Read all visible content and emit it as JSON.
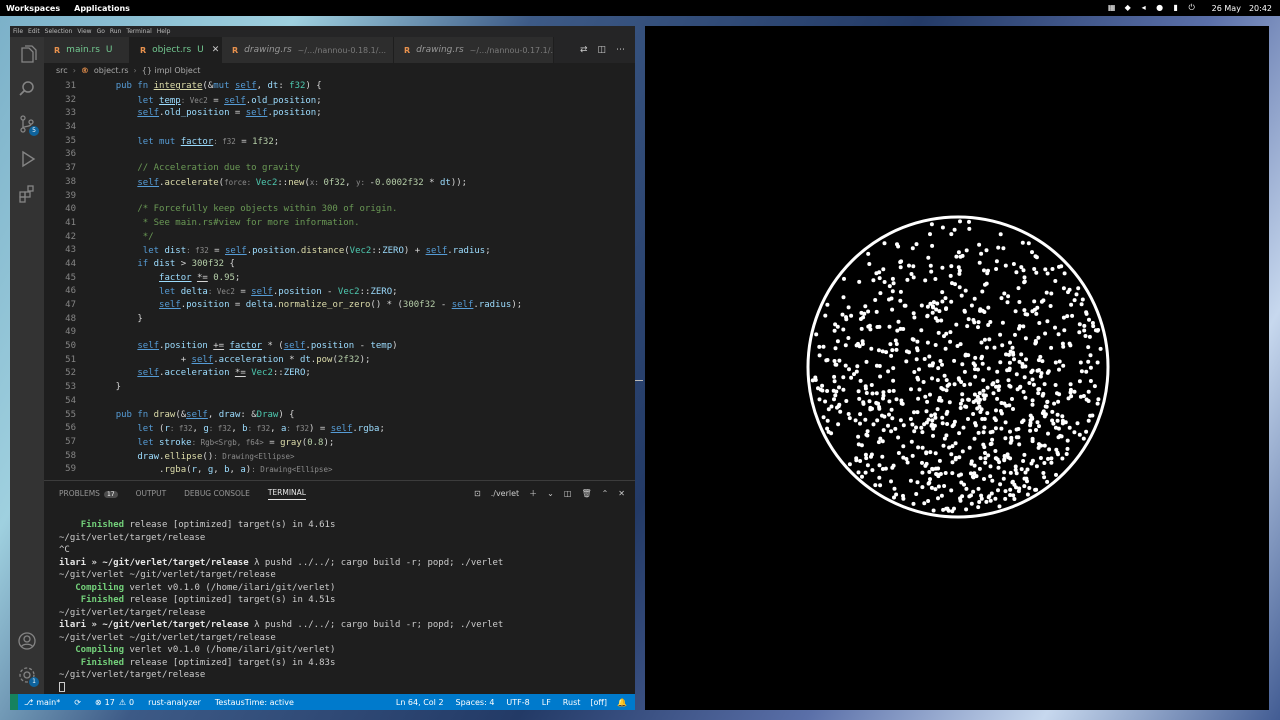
{
  "topbar": {
    "workspaces": "Workspaces",
    "applications": "Applications",
    "date": "26 May",
    "time": "20:42"
  },
  "menubar": [
    "File",
    "Edit",
    "Selection",
    "View",
    "Go",
    "Run",
    "Terminal",
    "Help"
  ],
  "tabs": [
    {
      "icon": "R",
      "name": "main.rs",
      "mod": "U",
      "dir": "",
      "active": false
    },
    {
      "icon": "R",
      "name": "object.rs",
      "mod": "U",
      "dir": "",
      "active": true
    },
    {
      "icon": "R",
      "name": "drawing.rs",
      "mod": "",
      "dir": "~/.../nannou-0.18.1/...",
      "active": false
    },
    {
      "icon": "R",
      "name": "drawing.rs",
      "mod": "",
      "dir": "~/.../nannou-0.17.1/...",
      "active": false
    }
  ],
  "breadcrumb": {
    "folder": "src",
    "file": "object.rs",
    "symbol": "{} impl Object"
  },
  "activity": {
    "scm_badge": "5",
    "settings_badge": "1"
  },
  "code": {
    "line_numbers": [
      "31",
      "32",
      "33",
      "34",
      "35",
      "36",
      "37",
      "38",
      "39",
      "40",
      "41",
      "42",
      "43",
      "44",
      "45",
      "46",
      "47",
      "48",
      "49",
      "50",
      "51",
      "52",
      "53",
      "54",
      "55",
      "56",
      "57",
      "58",
      "59"
    ]
  },
  "panel": {
    "tabs": [
      "PROBLEMS",
      "OUTPUT",
      "DEBUG CONSOLE",
      "TERMINAL"
    ],
    "problems_count": "17",
    "terminal_name": "./verlet"
  },
  "terminal": {
    "lines": [
      {
        "parts": [
          {
            "t": "    ",
            "c": ""
          },
          {
            "t": "Finished",
            "c": "g"
          },
          {
            "t": " release [optimized] target(s) in 4.61s",
            "c": ""
          }
        ]
      },
      {
        "parts": [
          {
            "t": "~/git/verlet/target/release",
            "c": ""
          }
        ]
      },
      {
        "parts": [
          {
            "t": "^C",
            "c": ""
          }
        ]
      },
      {
        "parts": [
          {
            "t": "ilari » ~/git/verlet/target/release",
            "c": "b"
          },
          {
            "t": " λ pushd ../../; cargo build -r; popd; ./verlet",
            "c": ""
          }
        ]
      },
      {
        "parts": [
          {
            "t": "~/git/verlet ~/git/verlet/target/release",
            "c": ""
          }
        ]
      },
      {
        "parts": [
          {
            "t": "   ",
            "c": ""
          },
          {
            "t": "Compiling",
            "c": "g"
          },
          {
            "t": " verlet v0.1.0 (/home/ilari/git/verlet)",
            "c": ""
          }
        ]
      },
      {
        "parts": [
          {
            "t": "    ",
            "c": ""
          },
          {
            "t": "Finished",
            "c": "g"
          },
          {
            "t": " release [optimized] target(s) in 4.51s",
            "c": ""
          }
        ]
      },
      {
        "parts": [
          {
            "t": "~/git/verlet/target/release",
            "c": ""
          }
        ]
      },
      {
        "parts": [
          {
            "t": "ilari » ~/git/verlet/target/release",
            "c": "b"
          },
          {
            "t": " λ pushd ../../; cargo build -r; popd; ./verlet",
            "c": ""
          }
        ]
      },
      {
        "parts": [
          {
            "t": "~/git/verlet ~/git/verlet/target/release",
            "c": ""
          }
        ]
      },
      {
        "parts": [
          {
            "t": "   ",
            "c": ""
          },
          {
            "t": "Compiling",
            "c": "g"
          },
          {
            "t": " verlet v0.1.0 (/home/ilari/git/verlet)",
            "c": ""
          }
        ]
      },
      {
        "parts": [
          {
            "t": "    ",
            "c": ""
          },
          {
            "t": "Finished",
            "c": "g"
          },
          {
            "t": " release [optimized] target(s) in 4.83s",
            "c": ""
          }
        ]
      },
      {
        "parts": [
          {
            "t": "~/git/verlet/target/release",
            "c": ""
          }
        ]
      }
    ]
  },
  "statusbar": {
    "branch": "main*",
    "errors": "17",
    "warnings": "0",
    "analyzer": "rust-analyzer",
    "testaustime": "TestausTime: active",
    "position": "Ln 64, Col 2",
    "spaces": "Spaces: 4",
    "encoding": "UTF-8",
    "eol": "LF",
    "language": "Rust",
    "off": "[off]"
  },
  "simulation": {
    "particle_count": 900,
    "colors": {
      "background": "#000000",
      "ring": "#ffffff",
      "particle": "#ffffff"
    }
  }
}
